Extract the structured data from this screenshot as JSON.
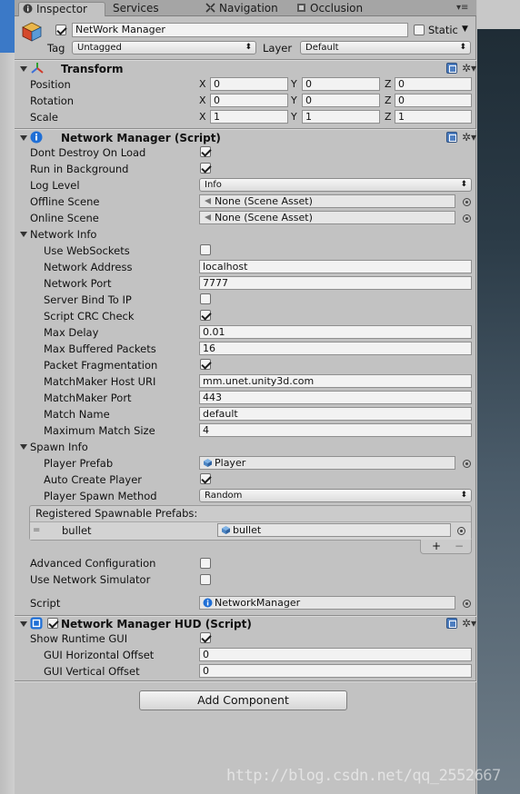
{
  "tabs": [
    {
      "label": "Inspector",
      "active": true,
      "icon": "info-icon"
    },
    {
      "label": "Services",
      "active": false
    },
    {
      "label": "Navigation",
      "active": false,
      "icon": "navigation-icon"
    },
    {
      "label": "Occlusion",
      "active": false,
      "icon": "occlusion-icon"
    }
  ],
  "object": {
    "name": "NetWork Manager",
    "static_label": "Static",
    "tag_label": "Tag",
    "tag_value": "Untagged",
    "layer_label": "Layer",
    "layer_value": "Default"
  },
  "transform": {
    "title": "Transform",
    "position_label": "Position",
    "rotation_label": "Rotation",
    "scale_label": "Scale",
    "axes": [
      "X",
      "Y",
      "Z"
    ],
    "position": [
      "0",
      "0",
      "0"
    ],
    "rotation": [
      "0",
      "0",
      "0"
    ],
    "scale": [
      "1",
      "1",
      "1"
    ]
  },
  "network_manager": {
    "title": "Network Manager (Script)",
    "dont_destroy_label": "Dont Destroy On Load",
    "run_in_bg_label": "Run in Background",
    "log_level_label": "Log Level",
    "log_level_value": "Info",
    "offline_scene_label": "Offline Scene",
    "offline_scene_value": "None (Scene Asset)",
    "online_scene_label": "Online Scene",
    "online_scene_value": "None (Scene Asset)",
    "network_info_label": "Network Info",
    "use_websockets_label": "Use WebSockets",
    "network_address_label": "Network Address",
    "network_address_value": "localhost",
    "network_port_label": "Network Port",
    "network_port_value": "7777",
    "server_bind_label": "Server Bind To IP",
    "script_crc_label": "Script CRC Check",
    "max_delay_label": "Max Delay",
    "max_delay_value": "0.01",
    "max_buffered_label": "Max Buffered Packets",
    "max_buffered_value": "16",
    "packet_frag_label": "Packet Fragmentation",
    "mm_host_label": "MatchMaker Host URI",
    "mm_host_value": "mm.unet.unity3d.com",
    "mm_port_label": "MatchMaker Port",
    "mm_port_value": "443",
    "match_name_label": "Match Name",
    "match_name_value": "default",
    "max_match_size_label": "Maximum Match Size",
    "max_match_size_value": "4",
    "spawn_info_label": "Spawn Info",
    "player_prefab_label": "Player Prefab",
    "player_prefab_value": "Player",
    "auto_create_label": "Auto Create Player",
    "spawn_method_label": "Player Spawn Method",
    "spawn_method_value": "Random",
    "registered_label": "Registered Spawnable Prefabs:",
    "prefab_item_label": "bullet",
    "prefab_item_value": "bullet",
    "list_add": "+",
    "list_remove": "−",
    "advanced_label": "Advanced Configuration",
    "use_simulator_label": "Use Network Simulator",
    "script_label": "Script",
    "script_value": "NetworkManager"
  },
  "hud": {
    "title": "Network Manager HUD (Script)",
    "show_gui_label": "Show Runtime GUI",
    "h_offset_label": "GUI Horizontal Offset",
    "h_offset_value": "0",
    "v_offset_label": "GUI Vertical Offset",
    "v_offset_value": "0"
  },
  "add_component_label": "Add Component",
  "watermark": "http://blog.csdn.net/qq_2552667"
}
